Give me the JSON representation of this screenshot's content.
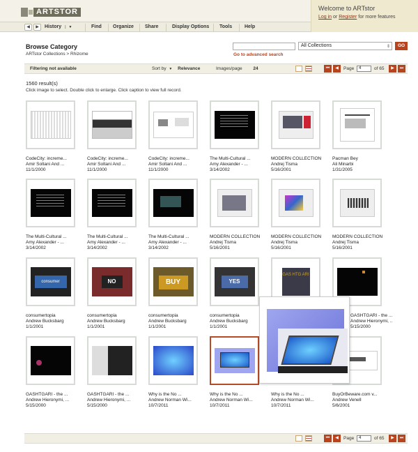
{
  "header": {
    "logo_text": "ARTSTOR",
    "welcome_title": "Welcome to ARTstor",
    "login_label": "Log in",
    "or_text": "or",
    "register_label": "Register",
    "features_text": "for more features"
  },
  "nav": {
    "back": "◀",
    "forward": "▶",
    "history": "History",
    "history_arrow": "▼",
    "find": "Find",
    "organize": "Organize",
    "share": "Share",
    "display_options": "Display Options",
    "tools": "Tools",
    "help": "Help"
  },
  "page": {
    "title": "Browse Category",
    "breadcrumb": "ARTstor Collections > Rhizome",
    "search_value": "",
    "collection_select": "All Collections",
    "go_label": "GO",
    "advanced_link": "Go to advanced search"
  },
  "toolbar": {
    "filtering": "Filtering not available",
    "sort_by_label": "Sort by",
    "sort_arrow": "▼",
    "sort_value": "Relevance",
    "images_per_page_label": "Images/page",
    "images_per_page_value": "24",
    "page_label": "Page",
    "page_value": "4",
    "page_of": "of 65",
    "first": "⏮",
    "prev": "◀",
    "next": "▶",
    "last": "⏭"
  },
  "results": {
    "count": "1560 result(s)",
    "instructions": "Click image to select. Double click to enlarge. Click caption to view full record."
  },
  "items": [
    {
      "t": "CodeCity: increme...",
      "a": "Amir Soltani And ...",
      "d": "11/1/2000"
    },
    {
      "t": "CodeCity: increme...",
      "a": "Amir Soltani And ...",
      "d": "11/1/2000"
    },
    {
      "t": "CodeCity: increme...",
      "a": "Amir Soltani And ...",
      "d": "11/1/2000"
    },
    {
      "t": "The Multi-Cultural ...",
      "a": "Amy Alexander - ...",
      "d": "3/14/2002"
    },
    {
      "t": "MODERN COLLECTION",
      "a": "Andrej Tisma",
      "d": "5/16/2001"
    },
    {
      "t": "Pacman Bey",
      "a": "Ali Minarbi",
      "d": "1/31/2005"
    },
    {
      "t": "The Multi-Cultural ...",
      "a": "Amy Alexander - ...",
      "d": "3/14/2002"
    },
    {
      "t": "The Multi-Cultural ...",
      "a": "Amy Alexander - ...",
      "d": "3/14/2002"
    },
    {
      "t": "The Multi-Cultural ...",
      "a": "Amy Alexander - ...",
      "d": "3/14/2002"
    },
    {
      "t": "MODERN COLLECTION",
      "a": "Andrej Tisma",
      "d": "5/16/2001"
    },
    {
      "t": "MODERN COLLECTION",
      "a": "Andrej Tisma",
      "d": "5/16/2001"
    },
    {
      "t": "MODERN COLLECTION",
      "a": "Andrej Tisma",
      "d": "5/16/2001"
    },
    {
      "t": "consumertopia",
      "a": "Andrew Bucksbarg",
      "d": "1/1/2001"
    },
    {
      "t": "consumertopia",
      "a": "Andrew Bucksbarg",
      "d": "1/1/2001"
    },
    {
      "t": "consumertopia",
      "a": "Andrew Bucksbarg",
      "d": "1/1/2001"
    },
    {
      "t": "consumertopia",
      "a": "Andrew Bucksbarg",
      "d": "1/1/2001"
    },
    {
      "t": "",
      "a": "",
      "d": ""
    },
    {
      "t": "GASHTGARI - the ...",
      "a": "Andrew Hieronymi, ...",
      "d": "5/15/2000"
    },
    {
      "t": "GASHTGARI - the ...",
      "a": "Andrew Hieronymi, ...",
      "d": "5/15/2000"
    },
    {
      "t": "GASHTGARI - the ...",
      "a": "Andrew Hieronymi, ...",
      "d": "5/15/2000"
    },
    {
      "t": "Why is the No ...",
      "a": "Andrew Norman Wi...",
      "d": "10/7/2011"
    },
    {
      "t": "Why is the No ...",
      "a": "Andrew Norman Wi...",
      "d": "10/7/2011"
    },
    {
      "t": "Why is the No ...",
      "a": "Andrew Norman Wi...",
      "d": "10/7/2011"
    },
    {
      "t": "BuyOrBeware.com v...",
      "a": "Andrew Venell",
      "d": "5/6/2001"
    }
  ],
  "thumb_texts": {
    "consumertopia_1": "consumer",
    "consumertopia_2": "NO",
    "consumertopia_3": "BUY",
    "consumertopia_4": "YES",
    "gashtgari": "GAS HTG ARI"
  }
}
